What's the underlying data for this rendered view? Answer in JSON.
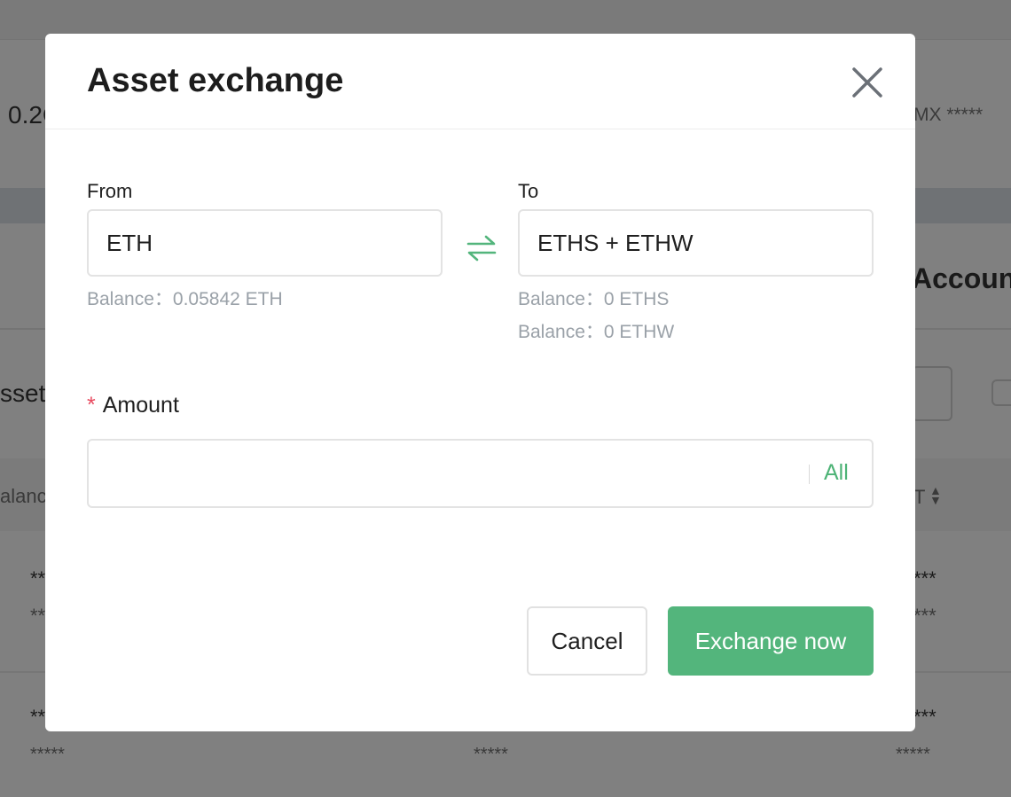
{
  "background": {
    "balance_value": "0.2C",
    "right_masked": "MX *****",
    "account_heading": "Accoun",
    "assets_label": "sset",
    "balance_col": "alanc",
    "sort_col": "T",
    "masked_values": [
      "**",
      "**",
      "***",
      "***",
      "**",
      "*****",
      "*****",
      "***",
      "*****"
    ]
  },
  "modal": {
    "title": "Asset exchange",
    "close_icon": "close-icon",
    "from": {
      "label": "From",
      "value": "ETH",
      "balance_label": "Balance：",
      "balance": "0.05842 ETH"
    },
    "swap_icon": "swap-arrows-icon",
    "to": {
      "label": "To",
      "value": "ETHS + ETHW",
      "balances": [
        {
          "label": "Balance：",
          "value": "0 ETHS"
        },
        {
          "label": "Balance：",
          "value": "0 ETHW"
        }
      ]
    },
    "amount": {
      "required_mark": "*",
      "label": "Amount",
      "value": "",
      "all_label": "All"
    },
    "buttons": {
      "cancel": "Cancel",
      "exchange": "Exchange now"
    }
  },
  "colors": {
    "accent": "#53b57c",
    "required": "#e84a5f",
    "muted_text": "#9aa1a8"
  }
}
